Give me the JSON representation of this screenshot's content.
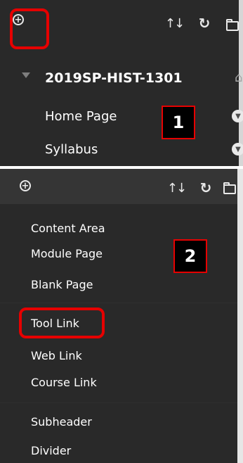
{
  "top_panel": {
    "course": {
      "title": "2019SP-HIST-1301"
    },
    "nav_items": [
      {
        "label": "Home Page"
      },
      {
        "label": "Syllabus"
      }
    ],
    "callout_number": "1"
  },
  "bottom_panel": {
    "menu_items": [
      {
        "label": "Content Area"
      },
      {
        "label": "Module Page"
      },
      {
        "label": "Blank Page"
      },
      {
        "label": "Tool Link"
      },
      {
        "label": "Web Link"
      },
      {
        "label": "Course Link"
      },
      {
        "label": "Subheader"
      },
      {
        "label": "Divider"
      }
    ],
    "callout_number": "2"
  },
  "icons": {
    "add": "plus-circle-icon",
    "sort": "sort-icon",
    "refresh": "refresh-icon",
    "folder": "folder-icon",
    "home": "home-icon",
    "chevron": "chevron-down-icon"
  },
  "colors": {
    "panel_bg": "#292929",
    "toolbar_bg": "#353535",
    "highlight": "#e60000",
    "text": "#ffffff"
  }
}
